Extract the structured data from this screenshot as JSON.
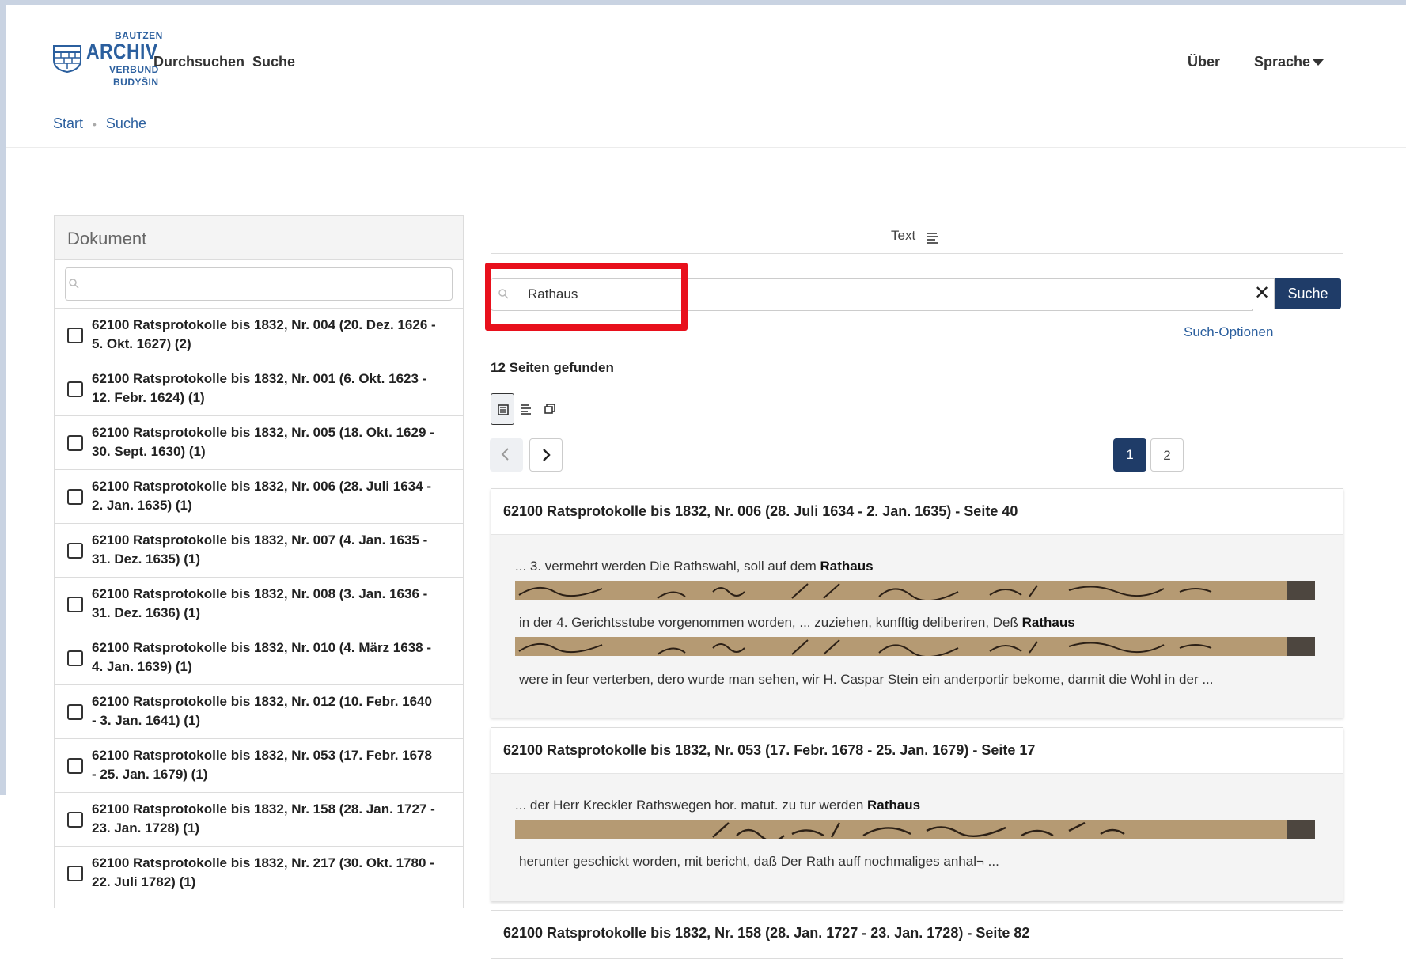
{
  "brand": {
    "line1": "BAUTZEN",
    "line2": "ARCHIV",
    "line3": "VERBUND",
    "line4": "BUDYŠIN"
  },
  "nav": {
    "browse": "Durchsuchen",
    "search": "Suche",
    "about": "Über",
    "language": "Sprache"
  },
  "breadcrumb": {
    "home": "Start",
    "current": "Suche"
  },
  "facet": {
    "title": "Dokument",
    "search_placeholder": "",
    "items": [
      {
        "label": "62100 Ratsprotokolle bis 1832, Nr. 004 (20. Dez. 1626 - 5. Okt. 1627) (2)",
        "checked": false
      },
      {
        "label": "62100 Ratsprotokolle bis 1832, Nr. 001 (6. Okt. 1623 - 12. Febr. 1624) (1)",
        "checked": false
      },
      {
        "label": "62100 Ratsprotokolle bis 1832, Nr. 005 (18. Okt. 1629 - 30. Sept. 1630) (1)",
        "checked": false
      },
      {
        "label": "62100 Ratsprotokolle bis 1832, Nr. 006 (28. Juli 1634 - 2. Jan. 1635) (1)",
        "checked": false
      },
      {
        "label": "62100 Ratsprotokolle bis 1832, Nr. 007 (4. Jan. 1635 - 31. Dez. 1635) (1)",
        "checked": false
      },
      {
        "label": "62100 Ratsprotokolle bis 1832, Nr. 008 (3. Jan. 1636 - 31. Dez. 1636) (1)",
        "checked": false
      },
      {
        "label": "62100 Ratsprotokolle bis 1832, Nr. 010 (4. März 1638 - 4. Jan. 1639) (1)",
        "checked": false
      },
      {
        "label": "62100 Ratsprotokolle bis 1832, Nr. 012 (10. Febr. 1640 - 3. Jan. 1641) (1)",
        "checked": false
      },
      {
        "label": "62100 Ratsprotokolle bis 1832, Nr. 053 (17. Febr. 1678 - 25. Jan. 1679) (1)",
        "checked": false
      },
      {
        "label": "62100 Ratsprotokolle bis 1832, Nr. 158 (28. Jan. 1727 - 23. Jan. 1728) (1)",
        "checked": false
      },
      {
        "label": "62100 Ratsprotokolle bis 1832, Nr. 217 (30. Okt. 1780 - 22. Juli 1782) (1)",
        "checked": false
      }
    ]
  },
  "view_tab": {
    "label": "Text",
    "icon": "text-lines-icon"
  },
  "search": {
    "value": "Rathaus",
    "clear_symbol": "✕",
    "button_label": "Suche",
    "options_label": "Such-Optionen"
  },
  "results": {
    "count_text": "12 Seiten gefunden",
    "pagination": {
      "current": "1",
      "other": "2"
    },
    "cards": [
      {
        "title": "62100 Ratsprotokolle bis 1832, Nr. 006 (28. Juli 1634 - 2. Jan. 1635) - Seite 40",
        "snippets": [
          {
            "pre": "... 3. vermehrt werden Die Rathswahl, soll auf dem ",
            "hit": "Rathaus",
            "post": ""
          },
          {
            "pre": "in der 4. Gerichtsstube vorgenommen worden, ...  zuziehen, kunfftig deliberiren, Deß ",
            "hit": "Rathaus",
            "post": ""
          },
          {
            "pre": "were in feur verterben, dero wurde man sehen, wir H. Caspar Stein ein anderportir bekome, darmit die Wohl in der ...",
            "hit": "",
            "post": ""
          }
        ]
      },
      {
        "title": "62100 Ratsprotokolle bis 1832, Nr. 053 (17. Febr. 1678 - 25. Jan. 1679) - Seite 17",
        "snippets": [
          {
            "pre": "... der Herr Kreckler Rathswegen hor. matut. zu tur werden ",
            "hit": "Rathaus",
            "post": ""
          },
          {
            "pre": "herunter geschickt worden, mit bericht, daß Der Rath auff nochmaliges anhal¬ ...",
            "hit": "",
            "post": ""
          }
        ]
      },
      {
        "title": "62100 Ratsprotokolle bis 1832, Nr. 158 (28. Jan. 1727 - 23. Jan. 1728) - Seite 82",
        "snippets": []
      }
    ]
  },
  "colors": {
    "brand_blue": "#2b5f9e",
    "button_navy": "#1f3c68",
    "highlight_red": "#e8101c",
    "page_border": "#c9d3e2"
  }
}
